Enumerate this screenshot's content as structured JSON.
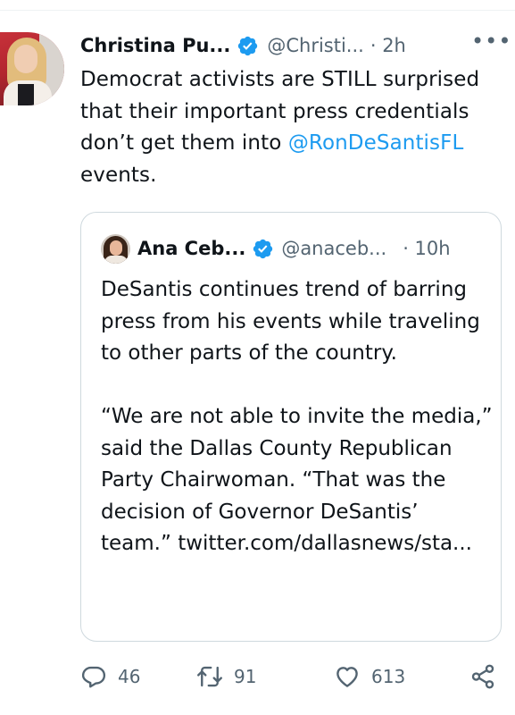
{
  "tweet": {
    "author_name": "Christina Pu...",
    "author_handle": "@Christi...",
    "time": "· 2h",
    "more": "•••",
    "text_before": "Democrat activists are STILL surprised that their important press credentials don’t get them into ",
    "mention": "@RonDeSantisFL",
    "text_after": " events."
  },
  "quote": {
    "author_name": "Ana Ceb...",
    "author_handle": "@anaceb...",
    "time": "· 10h",
    "text": "DeSantis continues trend of barring press from his events while traveling to other parts of the country.\n\n“We are not able to invite the media,” said the Dallas County Republican Party Chairwoman. “That was the decision of Governor DeSantis’ team.” twitter.com/dallasnews/sta..."
  },
  "actions": {
    "replies": "46",
    "retweets": "91",
    "likes": "613"
  },
  "colors": {
    "accent": "#1d9bf0",
    "secondary_text": "#536471",
    "border": "#cfd9de"
  },
  "icons": [
    "verified-badge-icon",
    "more-icon",
    "reply-icon",
    "retweet-icon",
    "like-icon",
    "share-icon"
  ]
}
